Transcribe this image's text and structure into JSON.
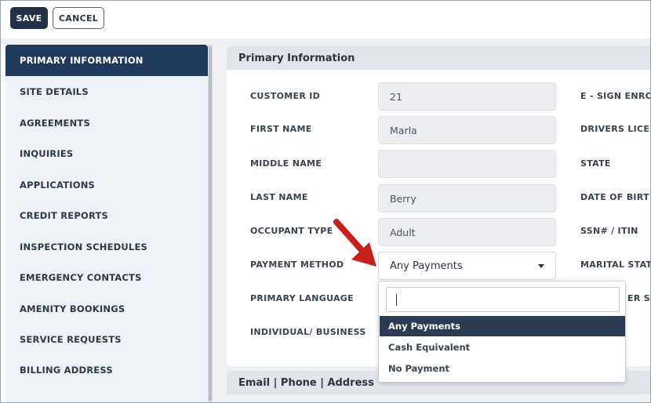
{
  "toolbar": {
    "save_label": "SAVE",
    "cancel_label": "CANCEL"
  },
  "sidebar": {
    "items": [
      {
        "label": "PRIMARY INFORMATION",
        "active": true
      },
      {
        "label": "SITE DETAILS"
      },
      {
        "label": "AGREEMENTS"
      },
      {
        "label": "INQUIRIES"
      },
      {
        "label": "APPLICATIONS"
      },
      {
        "label": "CREDIT REPORTS"
      },
      {
        "label": "INSPECTION SCHEDULES"
      },
      {
        "label": "EMERGENCY CONTACTS"
      },
      {
        "label": "AMENITY BOOKINGS"
      },
      {
        "label": "SERVICE REQUESTS"
      },
      {
        "label": "BILLING ADDRESS"
      }
    ]
  },
  "section": {
    "title": "Primary Information",
    "fields": {
      "customer_id": {
        "label": "CUSTOMER ID",
        "value": "21"
      },
      "first_name": {
        "label": "FIRST NAME",
        "value": "Marla"
      },
      "middle_name": {
        "label": "MIDDLE NAME",
        "value": ""
      },
      "last_name": {
        "label": "LAST NAME",
        "value": "Berry"
      },
      "occupant_type": {
        "label": "OCCUPANT TYPE",
        "value": "Adult"
      },
      "payment_method": {
        "label": "PAYMENT METHOD",
        "value": "Any Payments"
      },
      "primary_language": {
        "label": "PRIMARY LANGUAGE"
      },
      "individual_business": {
        "label": "INDIVIDUAL/ BUSINESS"
      }
    },
    "right_labels": {
      "esign": "E - SIGN ENRO",
      "drivers_license": "DRIVERS LICE",
      "state": "STATE",
      "dob": "DATE OF BIRT",
      "ssn": "SSN# / ITIN",
      "marital": "MARITAL STAT",
      "partial": "ER ST"
    }
  },
  "dropdown": {
    "search_value": "",
    "options": [
      "Any Payments",
      "Cash Equivalent",
      "No Payment"
    ],
    "selected": "Any Payments"
  },
  "section2": {
    "title": "Email | Phone | Address"
  },
  "colors": {
    "primary_dark": "#1f3a5c",
    "arrow": "#c81f1f",
    "selected_option": "#2c3b54"
  }
}
